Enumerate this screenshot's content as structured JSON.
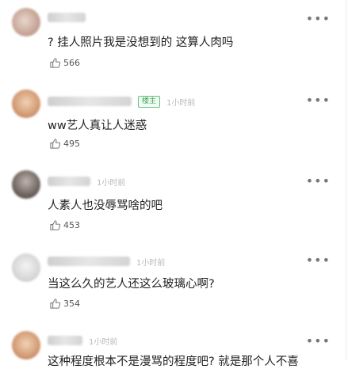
{
  "comments": [
    {
      "text": "? 挂人照片我是没想到的 这算人肉吗",
      "likes": "566",
      "more": "•••",
      "like_icon": "thumbs-up-icon"
    },
    {
      "badge": "楼主",
      "time": "1小时前",
      "text": "ww艺人真让人迷惑",
      "likes": "495",
      "more": "•••",
      "like_icon": "thumbs-up-icon"
    },
    {
      "time": "1小时前",
      "text": "人素人也没辱骂啥的吧",
      "likes": "453",
      "more": "•••",
      "like_icon": "thumbs-up-icon"
    },
    {
      "time": "1小时前",
      "text": "当这么久的艺人还这么玻璃心啊?",
      "likes": "354",
      "more": "•••",
      "like_icon": "thumbs-up-icon"
    },
    {
      "time": "1小时前",
      "text": "这种程度根本不是漫骂的程度吧? 就是那个人不喜",
      "more": "•••"
    }
  ],
  "colors": {
    "badge_green": "#3aa65a",
    "time_gray": "#b8b8b8",
    "text": "#222222"
  }
}
